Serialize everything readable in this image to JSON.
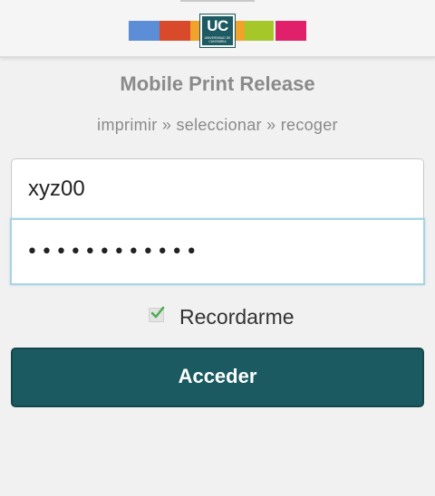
{
  "header": {
    "logo": {
      "text": "UC",
      "subtext": "UNIVERSIDAD DE CANTABRIA",
      "stripe_colors": [
        "#5b8ed6",
        "#d94a2b",
        "#f0a22a",
        "#1e5a61",
        "#a5c72a",
        "#e0206a"
      ]
    }
  },
  "login": {
    "title": "Mobile Print Release",
    "steps": "imprimir » seleccionar » recoger",
    "username_value": "xyz00",
    "password_value": "••••••••••••",
    "remember_label": "Recordarme",
    "remember_checked": true,
    "submit_label": "Acceder"
  },
  "colors": {
    "accent": "#1b5a60",
    "focus_border": "#a8d4e6",
    "check": "#4caf50"
  }
}
